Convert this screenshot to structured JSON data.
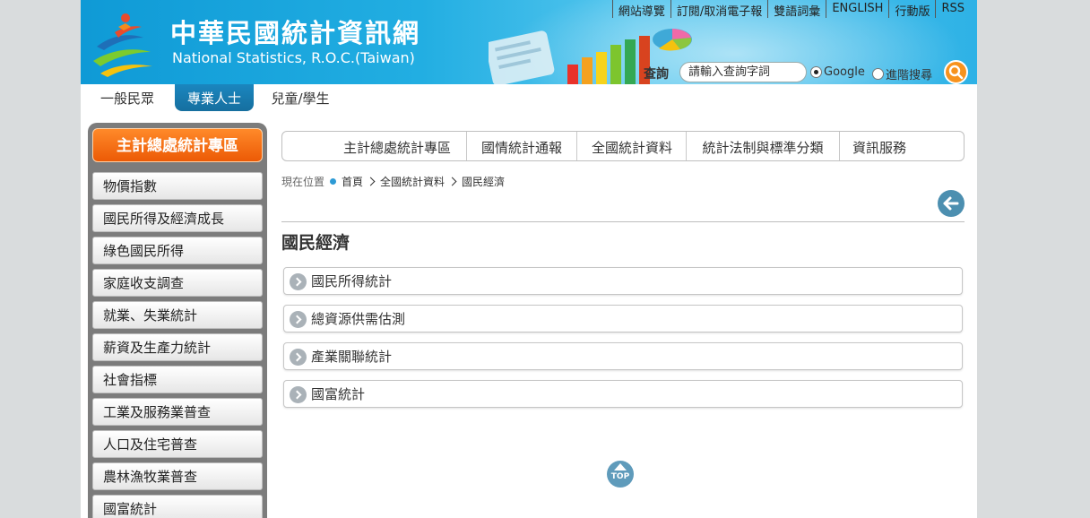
{
  "header": {
    "title_zh": "中華民國統計資訊網",
    "title_en": "National Statistics, R.O.C.(Taiwan)",
    "top_links": [
      "網站導覽",
      "訂閱/取消電子報",
      "雙語詞彙",
      "ENGLISH",
      "行動版",
      "RSS"
    ]
  },
  "search": {
    "label": "查詢",
    "placeholder": "請輸入查詢字詞",
    "option_google": "Google",
    "option_advanced": "進階搜尋",
    "selected": "Google"
  },
  "audience_tabs": [
    "一般民眾",
    "專業人士",
    "兒童/學生"
  ],
  "audience_active": "專業人士",
  "sidebar": {
    "header": "主計總處統計專區",
    "items": [
      "物價指數",
      "國民所得及經濟成長",
      "綠色國民所得",
      "家庭收支調查",
      "就業、失業統計",
      "薪資及生產力統計",
      "社會指標",
      "工業及服務業普查",
      "人口及住宅普查",
      "農林漁牧業普查",
      "國富統計"
    ]
  },
  "main_nav": [
    "主計總處統計專區",
    "國情統計通報",
    "全國統計資料",
    "統計法制與標準分類",
    "資訊服務"
  ],
  "breadcrumb": {
    "label": "現在位置",
    "items": [
      "首頁",
      "全國統計資料",
      "國民經濟"
    ]
  },
  "page_title": "國民經濟",
  "categories": [
    "國民所得統計",
    "總資源供需估測",
    "產業關聯統計",
    "國富統計"
  ],
  "top_button_label": "TOP",
  "colors": {
    "banner": "#1ba4dc",
    "accent_orange": "#f7931e",
    "active_tab": "#1a7fb3",
    "sidebar_bg": "#7c7c7c"
  },
  "icons": {
    "search": "magnifier-icon",
    "back": "arrow-left-icon",
    "top": "arrow-up-icon",
    "category": "chevron-right-icon"
  }
}
